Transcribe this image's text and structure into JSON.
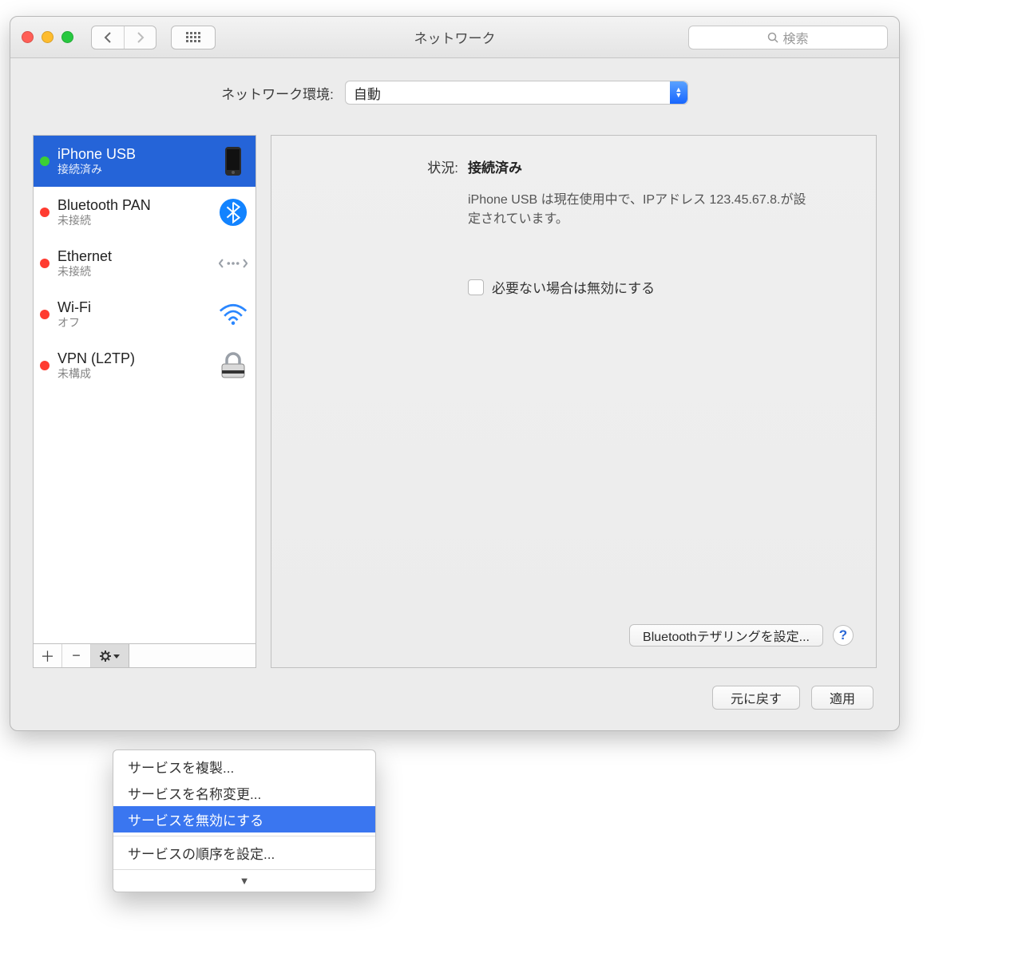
{
  "window": {
    "title": "ネットワーク",
    "search_placeholder": "検索"
  },
  "location": {
    "label": "ネットワーク環境:",
    "value": "自動"
  },
  "services": [
    {
      "name": "iPhone USB",
      "status": "接続済み",
      "dot": "green",
      "icon": "iphone",
      "selected": true
    },
    {
      "name": "Bluetooth PAN",
      "status": "未接続",
      "dot": "red",
      "icon": "bluetooth",
      "selected": false
    },
    {
      "name": "Ethernet",
      "status": "未接続",
      "dot": "red",
      "icon": "ethernet",
      "selected": false
    },
    {
      "name": "Wi-Fi",
      "status": "オフ",
      "dot": "red",
      "icon": "wifi",
      "selected": false
    },
    {
      "name": "VPN (L2TP)",
      "status": "未構成",
      "dot": "red",
      "icon": "lock",
      "selected": false
    }
  ],
  "detail": {
    "status_label": "状況:",
    "status_value": "接続済み",
    "description": "iPhone USB は現在使用中で、IPアドレス 123.45.67.8.が設定されています。",
    "checkbox": "必要ない場合は無効にする",
    "configure_button": "Bluetoothテザリングを設定..."
  },
  "footer": {
    "revert": "元に戻す",
    "apply": "適用"
  },
  "menu": {
    "items": [
      "サービスを複製...",
      "サービスを名称変更...",
      "サービスを無効にする",
      "サービスの順序を設定..."
    ],
    "selected_index": 2
  }
}
